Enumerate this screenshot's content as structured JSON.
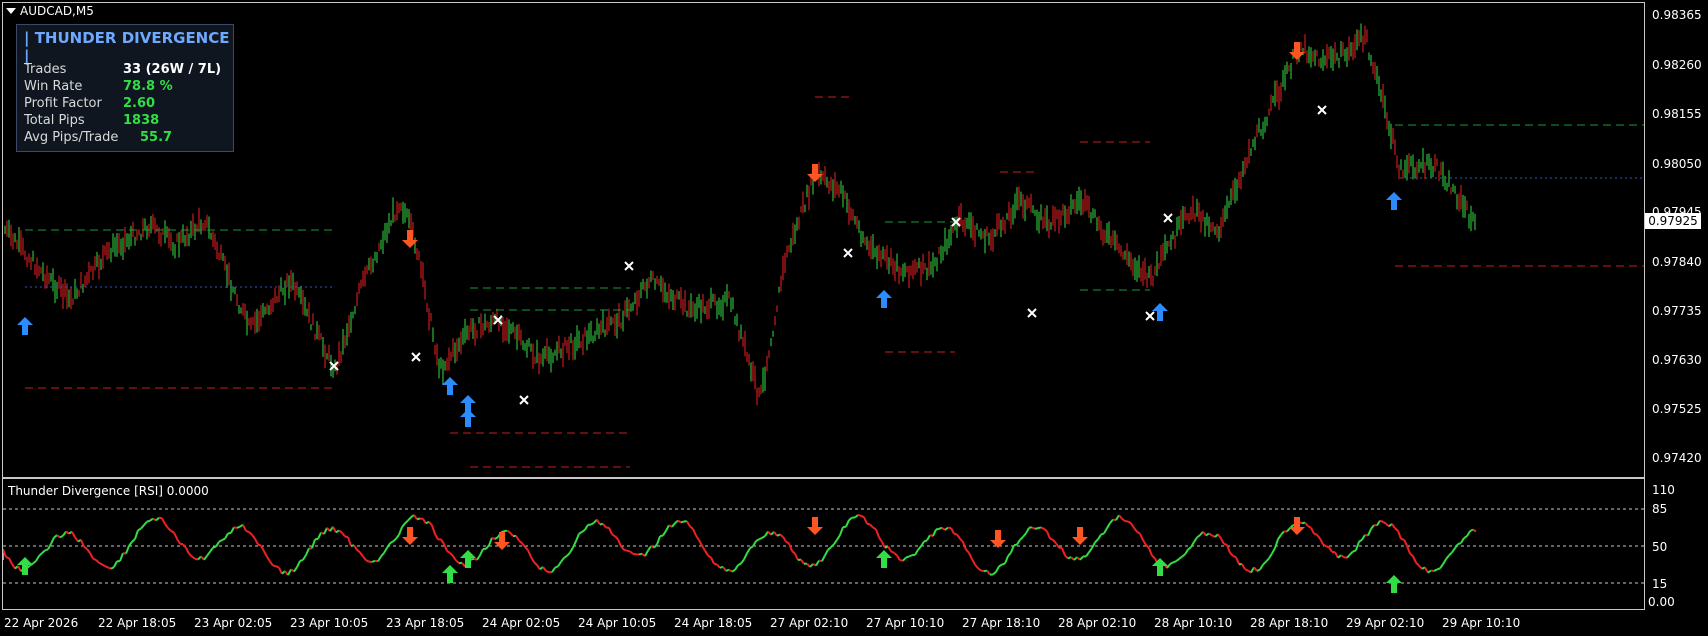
{
  "symbol": "AUDCAD,M5",
  "current_price": "0.97925",
  "price_axis": [
    "0.98365",
    "0.98260",
    "0.98155",
    "0.98050",
    "0.97945",
    "0.97840",
    "0.97735",
    "0.97630",
    "0.97525",
    "0.97420"
  ],
  "stats_panel": {
    "title": "| THUNDER DIVERGENCE |",
    "rows": [
      {
        "label": "Trades",
        "value": "33  (26W / 7L)",
        "color": "#ffffff"
      },
      {
        "label": "Win Rate",
        "value": "78.8 %",
        "color": "#33dd44"
      },
      {
        "label": "Profit Factor",
        "value": "2.60",
        "color": "#33dd44"
      },
      {
        "label": "Total Pips",
        "value": "1838",
        "color": "#33dd44"
      },
      {
        "label": "Avg Pips/Trade",
        "value": "55.7",
        "color": "#33dd44"
      }
    ]
  },
  "indicator": {
    "title": "Thunder Divergence [RSI] 0.0000",
    "axis": [
      "110",
      "85",
      "50",
      "15",
      "0.00"
    ],
    "overbought": 85,
    "midline": 50,
    "oversold": 15
  },
  "time_axis": [
    "22 Apr 2026",
    "22 Apr 18:05",
    "23 Apr 02:05",
    "23 Apr 10:05",
    "23 Apr 18:05",
    "24 Apr 02:05",
    "24 Apr 10:05",
    "24 Apr 18:05",
    "27 Apr 02:10",
    "27 Apr 10:10",
    "27 Apr 18:10",
    "28 Apr 02:10",
    "28 Apr 10:10",
    "28 Apr 18:10",
    "29 Apr 02:10",
    "29 Apr 10:10"
  ],
  "colors": {
    "bull": "#33dd44",
    "bear": "#ee2222",
    "buy_arrow": "#2a8cff",
    "sell_arrow": "#ff5522",
    "grid": "#c8c8c8"
  },
  "icons": {
    "buy": "up-arrow-icon",
    "sell": "down-arrow-icon",
    "exit": "x-mark-icon"
  }
}
